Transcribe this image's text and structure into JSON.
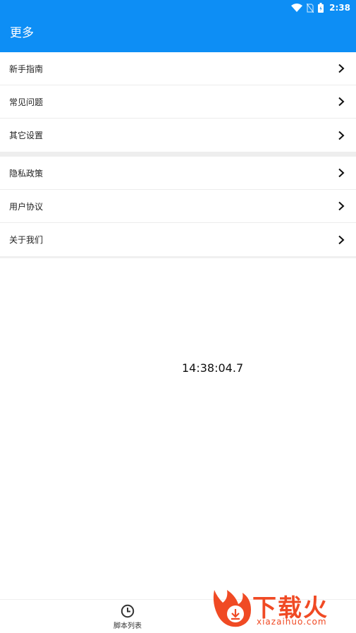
{
  "status_bar": {
    "time": "2:38",
    "icons": [
      "wifi-icon",
      "no-sim-icon",
      "battery-icon"
    ]
  },
  "app_bar": {
    "title": "更多",
    "color": "#0d8ef5"
  },
  "menu": {
    "group1": [
      {
        "label": "新手指南"
      },
      {
        "label": "常见问题"
      },
      {
        "label": "其它设置"
      }
    ],
    "group2": [
      {
        "label": "隐私政策"
      },
      {
        "label": "用户协议"
      },
      {
        "label": "关于我们"
      }
    ]
  },
  "main": {
    "clock": "14:38:04.7"
  },
  "bottom_nav": {
    "tabs": [
      {
        "label": "脚本列表",
        "icon": "clock-icon"
      }
    ]
  },
  "watermark": {
    "brand": "下载火",
    "domain": "xiazaihuo.com",
    "color": "#f04a24"
  }
}
